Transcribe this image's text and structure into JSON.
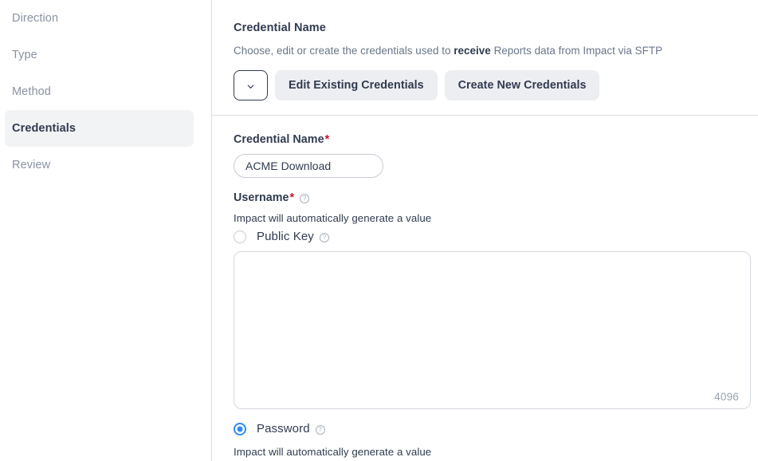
{
  "sidebar": {
    "items": [
      {
        "label": "Direction",
        "active": false
      },
      {
        "label": "Type",
        "active": false
      },
      {
        "label": "Method",
        "active": false
      },
      {
        "label": "Credentials",
        "active": true
      },
      {
        "label": "Review",
        "active": false
      }
    ]
  },
  "header": {
    "title": "Credential Name",
    "description_before": "Choose, edit or create the credentials used to ",
    "description_bold": "receive",
    "description_after": " Reports data from Impact via SFTP"
  },
  "toolbar": {
    "dropdown_icon": "chevron-down-icon",
    "edit_existing_label": "Edit Existing Credentials",
    "create_new_label": "Create New Credentials"
  },
  "form": {
    "credential_name": {
      "label": "Credential Name",
      "required_marker": "*",
      "value": "ACME Download",
      "placeholder": ""
    },
    "username": {
      "label": "Username",
      "required_marker": "*",
      "info_icon": "help-circle-icon",
      "helper_text": "Impact will automatically generate a value"
    },
    "public_key": {
      "label": "Public Key",
      "info_icon": "help-circle-icon",
      "selected": false,
      "textarea_value": "",
      "char_count": "4096"
    },
    "password": {
      "label": "Password",
      "info_icon": "help-circle-icon",
      "selected": true,
      "helper_text": "Impact will automatically generate a value"
    }
  },
  "colors": {
    "accent": "#2D8CF0",
    "text": "#303B50",
    "muted": "#8A93A3",
    "required": "#C8102E",
    "button_bg": "#EDEEF1",
    "border": "#DCDFE3"
  },
  "icons": {
    "info_glyph": "?"
  }
}
